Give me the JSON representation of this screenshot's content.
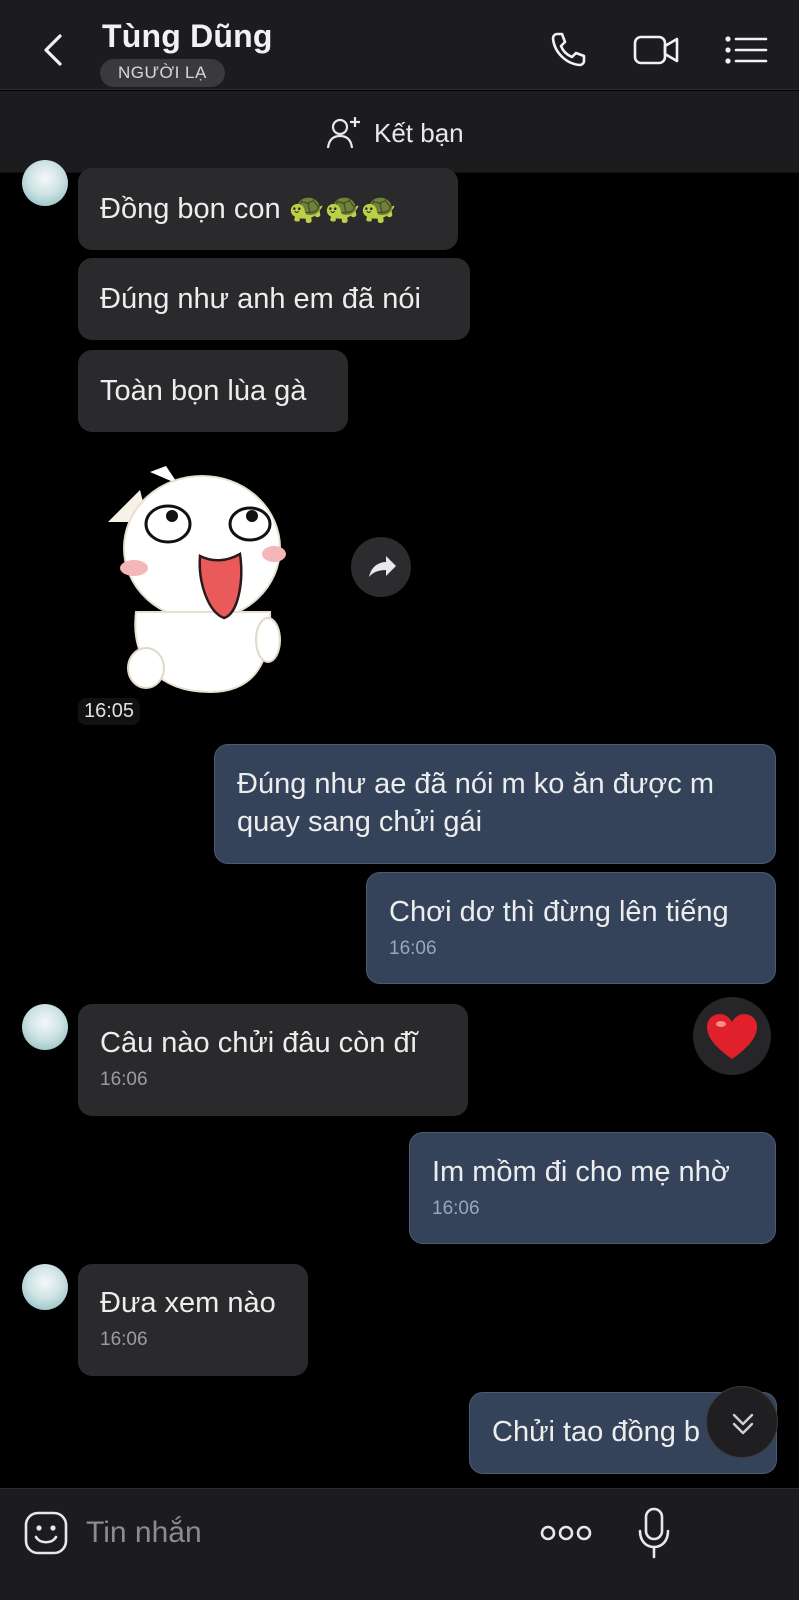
{
  "header": {
    "contact_name": "Tùng Dũng",
    "badge": "NGƯỜI LẠ",
    "icons": [
      "back-icon",
      "phone-icon",
      "video-icon",
      "menu-list-icon"
    ]
  },
  "add_friend": {
    "label": "Kết bạn",
    "icon": "add-user-icon"
  },
  "messages": [
    {
      "side": "in",
      "text": "Đồng bọn con 🐢🐢🐢"
    },
    {
      "side": "in",
      "text": "Đúng như anh em đã nói"
    },
    {
      "side": "in",
      "text": "Toàn bọn lùa gà"
    },
    {
      "side": "in",
      "type": "sticker",
      "time": "16:05"
    },
    {
      "side": "out",
      "text": "Đúng như ae đã nói m ko ăn được m quay sang chửi gái"
    },
    {
      "side": "out",
      "text": "Chơi dơ thì đừng lên tiếng",
      "time": "16:06"
    },
    {
      "side": "in",
      "text": "Câu nào chửi đâu còn đĩ",
      "time": "16:06",
      "reaction": "❤️"
    },
    {
      "side": "out",
      "text": "Im mồm đi cho mẹ nhờ",
      "time": "16:06"
    },
    {
      "side": "in",
      "text": "Đưa xem nào",
      "time": "16:06"
    },
    {
      "side": "out",
      "text": "Chửi tao đồng b"
    }
  ],
  "composer": {
    "placeholder": "Tin nhắn",
    "icons": [
      "emoji-icon",
      "more-options-icon",
      "microphone-icon"
    ]
  },
  "colors": {
    "background": "#000000",
    "header": "#1c1c1e",
    "incoming_bubble": "#2a2a2c",
    "outgoing_bubble": "#34435a"
  }
}
